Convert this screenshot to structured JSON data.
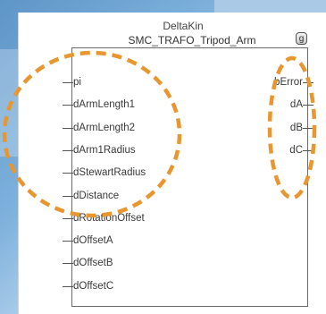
{
  "block": {
    "instance_name": "DeltaKin",
    "type_name": "SMC_TRAFO_Tripod_Arm",
    "close_glyph": "g",
    "inputs": [
      "pi",
      "dArmLength1",
      "dArmLength2",
      "dArm1Radius",
      "dStewartRadius",
      "dDistance",
      "dRotationOffset",
      "dOffsetA",
      "dOffsetB",
      "dOffsetC"
    ],
    "outputs": [
      "bError",
      "dA",
      "dB",
      "dC"
    ]
  },
  "annotations": {
    "highlight_color": "#e8962f"
  }
}
